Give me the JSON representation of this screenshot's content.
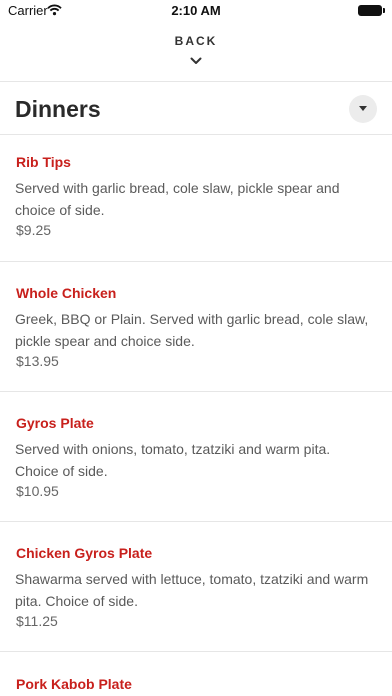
{
  "status_bar": {
    "carrier": "Carrier",
    "time": "2:10 AM"
  },
  "nav": {
    "back_label": "BACK"
  },
  "section": {
    "title": "Dinners"
  },
  "menu_items": [
    {
      "name": "Rib Tips",
      "description": "Served with garlic bread, cole slaw, pickle spear and choice of side.",
      "price": "$9.25"
    },
    {
      "name": "Whole Chicken",
      "description": "Greek, BBQ or Plain. Served with garlic bread, cole slaw, pickle spear and choice side.",
      "price": "$13.95"
    },
    {
      "name": "Gyros Plate",
      "description": "Served with onions, tomato, tzatziki and warm pita. Choice of side.",
      "price": "$10.95"
    },
    {
      "name": "Chicken Gyros Plate",
      "description": "Shawarma served with lettuce, tomato, tzatziki and warm pita. Choice of side.",
      "price": "$11.25"
    },
    {
      "name": "Pork Kabob Plate",
      "description": "",
      "price": ""
    }
  ],
  "colors": {
    "accent": "#c8201c",
    "divider": "#e6e6e6",
    "text_secondary": "#5a5a5a"
  }
}
